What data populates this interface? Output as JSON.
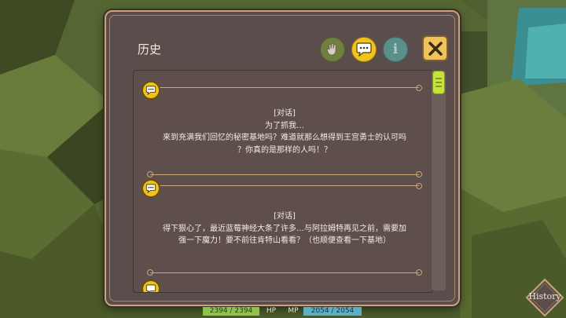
{
  "window": {
    "title": "历史"
  },
  "header_buttons": {
    "hand_icon": "hand-icon",
    "chat_icon": "speech-bubble-icon",
    "info_icon": "info-icon",
    "info_label": "i",
    "close_icon": "close-icon"
  },
  "entries": [
    {
      "icon": "speech-bubble-icon",
      "tag": "[对话]",
      "lines": [
        "为了抓我…",
        "来到充满我们回忆的秘密基地吗？难道就那么想得到王宫勇士的认可吗",
        "？你真的是那样的人吗！？"
      ]
    },
    {
      "icon": "speech-bubble-icon",
      "tag": "[对话]",
      "lines": [
        "得下狠心了，最近蓝莓神经大条了许多…与阿拉姆特再见之前，需要加",
        "强一下魔力！要不前往肯特山看看？（也顺便查看一下基地）"
      ]
    }
  ],
  "status": {
    "hp_value": "2394 / 2394",
    "hp_label": "HP",
    "mp_label": "MP",
    "mp_value": "2054 / 2054"
  },
  "history_button": {
    "label": "History"
  },
  "colors": {
    "panel_bg": "#5b4d4b",
    "frame_gold": "#c9a47a",
    "bubble_yellow": "#f2c21d",
    "scroll_green": "#c7e23c"
  }
}
